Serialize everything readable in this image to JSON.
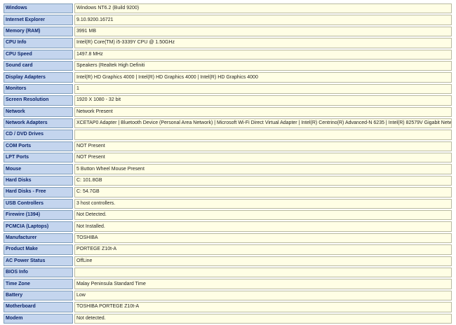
{
  "rows": [
    {
      "label": "Windows",
      "value": "Windows NT6.2 (Build 9200)"
    },
    {
      "label": "Internet Explorer",
      "value": "9.10.9200.16721"
    },
    {
      "label": "Memory (RAM)",
      "value": "3991 MB"
    },
    {
      "label": "CPU Info",
      "value": "Intel(R) Core(TM) i5-3339Y CPU @ 1.50GHz"
    },
    {
      "label": "CPU Speed",
      "value": "1497.8 MHz"
    },
    {
      "label": "Sound card",
      "value": "Speakers (Realtek High Definiti"
    },
    {
      "label": "Display Adapters",
      "value": "Intel(R) HD Graphics 4000 | Intel(R) HD Graphics 4000 | Intel(R) HD Graphics 4000"
    },
    {
      "label": "Monitors",
      "value": "1"
    },
    {
      "label": "Screen Resolution",
      "value": "1920 X 1080 - 32 bit"
    },
    {
      "label": "Network",
      "value": "Network Present"
    },
    {
      "label": "Network Adapters",
      "value": "XCETAP0 Adapter | Bluetooth Device (Personal Area Network) | Microsoft Wi-Fi Direct Virtual Adapter | Intel(R) Centrino(R) Advanced-N 6235 | Intel(R) 82579V Gigabit Network Connection"
    },
    {
      "label": "CD / DVD Drives",
      "value": ""
    },
    {
      "label": "COM Ports",
      "value": "NOT Present"
    },
    {
      "label": "LPT Ports",
      "value": "NOT Present"
    },
    {
      "label": "Mouse",
      "value": "5 Button Wheel Mouse Present"
    },
    {
      "label": "Hard Disks",
      "value": "C: 101.8GB"
    },
    {
      "label": "Hard Disks - Free",
      "value": "C: 54.7GB"
    },
    {
      "label": "USB Controllers",
      "value": "3 host controllers."
    },
    {
      "label": "Firewire (1394)",
      "value": "Not Detected."
    },
    {
      "label": "PCMCIA (Laptops)",
      "value": "Not Installed."
    },
    {
      "label": "Manufacturer",
      "value": "TOSHIBA"
    },
    {
      "label": "Product Make",
      "value": "PORTEGE Z10t-A"
    },
    {
      "label": "AC Power Status",
      "value": "OffLine"
    },
    {
      "label": "BIOS Info",
      "value": ""
    },
    {
      "label": "Time Zone",
      "value": "Malay Peninsula Standard Time"
    },
    {
      "label": "Battery",
      "value": "Low"
    },
    {
      "label": "Motherboard",
      "value": "TOSHIBA PORTEGE Z10t-A"
    },
    {
      "label": "Modem",
      "value": "Not detected."
    }
  ]
}
